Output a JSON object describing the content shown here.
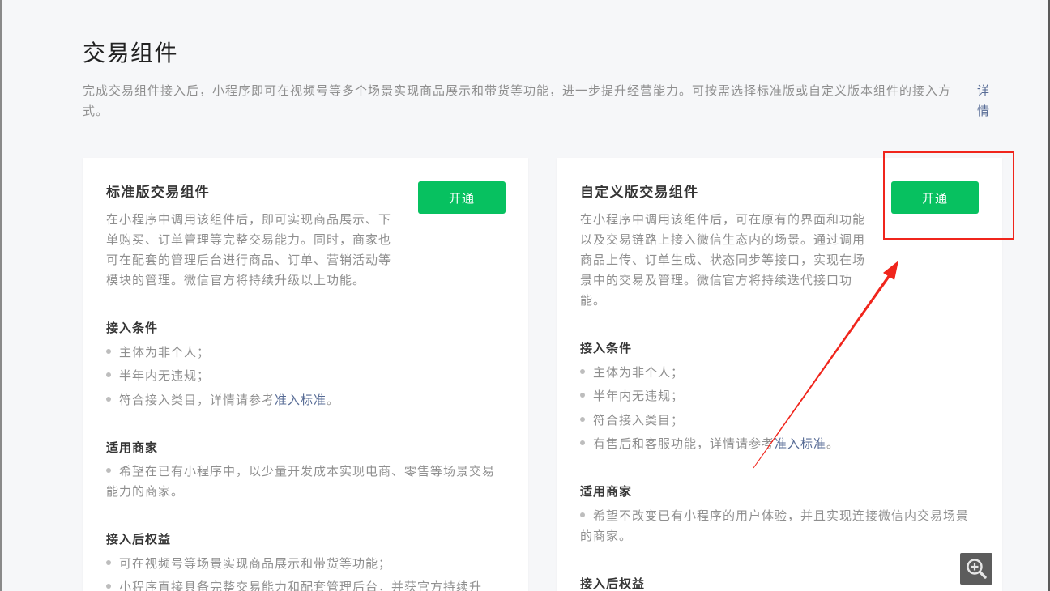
{
  "page": {
    "title": "交易组件",
    "description": "完成交易组件接入后，小程序即可在视频号等多个场景实现商品展示和带货等功能，进一步提升经营能力。可按需选择标准版或自定义版本组件的接入方式。",
    "detail_link": "详情"
  },
  "cards": [
    {
      "title": "标准版交易组件",
      "button_label": "开通",
      "description": "在小程序中调用该组件后，即可实现商品展示、下单购买、订单管理等完整交易能力。同时，商家也可在配套的管理后台进行商品、订单、营销活动等模块的管理。微信官方将持续升级以上功能。",
      "sections": [
        {
          "heading": "接入条件",
          "items": [
            {
              "text": "主体为非个人；"
            },
            {
              "text": "半年内无违规；"
            },
            {
              "text": "符合接入类目，详情请参考",
              "link": "准入标准",
              "suffix": "。"
            }
          ]
        },
        {
          "heading": "适用商家",
          "items": [
            {
              "text": "希望在已有小程序中，以少量开发成本实现电商、零售等场景交易能力的商家。"
            }
          ]
        },
        {
          "heading": "接入后权益",
          "items": [
            {
              "text": "可在视频号等场景实现商品展示和带货等功能；"
            },
            {
              "text": "小程序直接具备完整交易能力和配套管理后台，并获官方持续升"
            }
          ]
        }
      ]
    },
    {
      "title": "自定义版交易组件",
      "button_label": "开通",
      "description": "在小程序中调用该组件后，可在原有的界面和功能以及交易链路上接入微信生态内的场景。通过调用商品上传、订单生成、状态同步等接口，实现在场景中的交易及管理。微信官方将持续迭代接口功能。",
      "sections": [
        {
          "heading": "接入条件",
          "items": [
            {
              "text": "主体为非个人；"
            },
            {
              "text": "半年内无违规；"
            },
            {
              "text": "符合接入类目；"
            },
            {
              "text": "有售后和客服功能，详情请参考",
              "link": "准入标准",
              "suffix": "。"
            }
          ]
        },
        {
          "heading": "适用商家",
          "items": [
            {
              "text": "希望不改变已有小程序的用户体验，并且实现连接微信内交易场景的商家。"
            }
          ]
        },
        {
          "heading": "接入后权益",
          "items": []
        }
      ]
    }
  ],
  "icons": {
    "zoom": "zoom-in-icon"
  },
  "colors": {
    "accent_green": "#07c160",
    "link_blue": "#576b95",
    "annotation_red": "#f0251c",
    "background": "#f6f7f9"
  }
}
